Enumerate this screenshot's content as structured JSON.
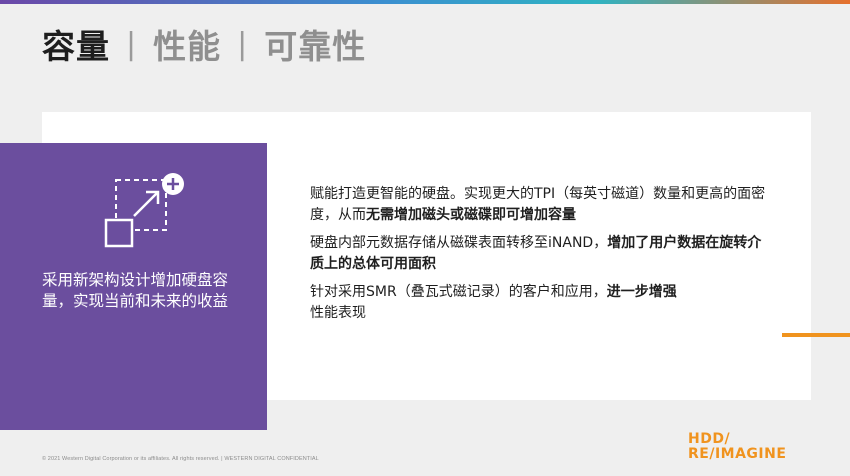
{
  "title": {
    "active": "容量",
    "separator": "|",
    "inactive_1": "性能",
    "inactive_2": "可靠性"
  },
  "left_panel": {
    "icon": "expand-plus-icon",
    "text": "采用新架构设计增加硬盘容量，实现当前和未来的收益"
  },
  "bullets": [
    {
      "normal": "赋能打造更智能的硬盘。实现更大的TPI（每英寸磁道）数量和更高的面密度，从而",
      "bold": "无需增加磁头或磁碟即可增加容量"
    },
    {
      "normal": "硬盘内部元数据存储从磁碟表面转移至iNAND，",
      "bold": "增加了用户数据在旋转介质上的总体可用面积"
    },
    {
      "normal": "针对采用SMR（叠瓦式磁记录）的客户和应用，",
      "bold": "进一步增强",
      "after": "性能表现"
    }
  ],
  "footer": {
    "text": "© 2021 Western Digital Corporation or its affiliates. All rights reserved.  |  WESTERN DIGITAL CONFIDENTIAL"
  },
  "logo": {
    "line1": "HDD/",
    "line2": "RE/IMAGINE"
  },
  "colors": {
    "purple": "#6b4e9e",
    "orange": "#f0931e"
  }
}
